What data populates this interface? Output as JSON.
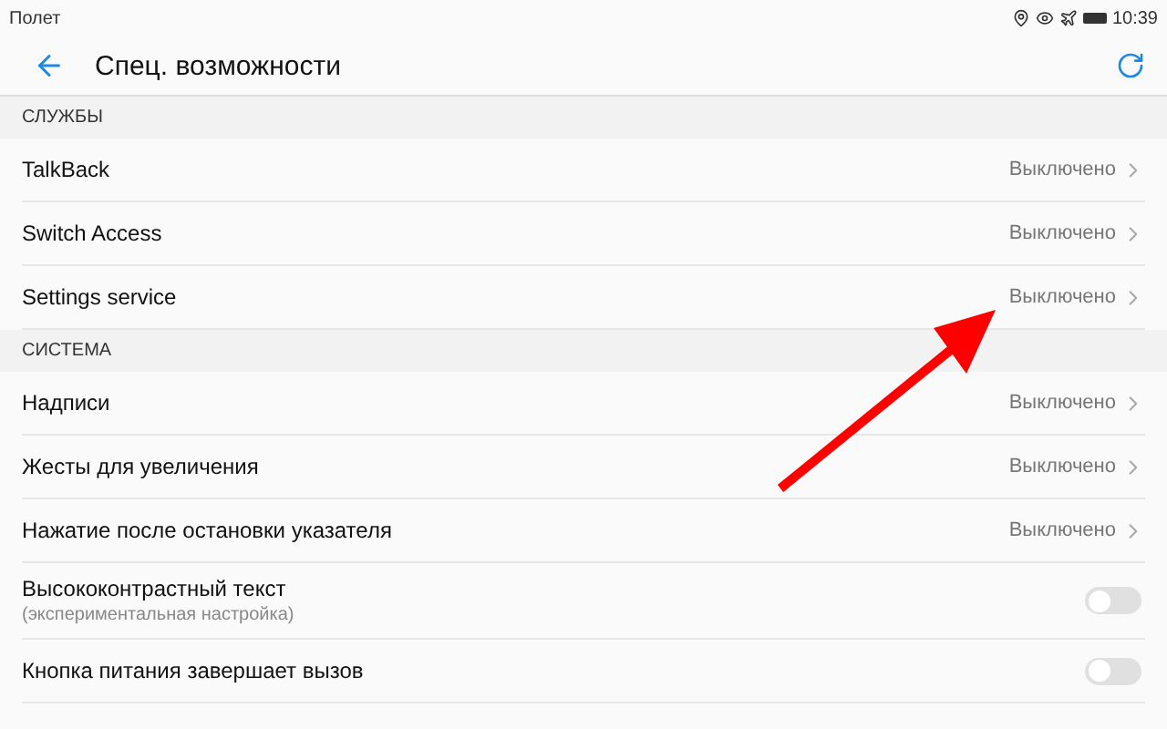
{
  "status_bar": {
    "carrier": "Полет",
    "time": "10:39"
  },
  "header": {
    "title": "Спец. возможности"
  },
  "sections": [
    {
      "title": "СЛУЖБЫ",
      "rows": [
        {
          "kind": "link",
          "label": "TalkBack",
          "value": "Выключено"
        },
        {
          "kind": "link",
          "label": "Switch Access",
          "value": "Выключено"
        },
        {
          "kind": "link",
          "label": "Settings service",
          "value": "Выключено"
        }
      ]
    },
    {
      "title": "СИСТЕМА",
      "rows": [
        {
          "kind": "link",
          "label": "Надписи",
          "value": "Выключено"
        },
        {
          "kind": "link",
          "label": "Жесты для увеличения",
          "value": "Выключено"
        },
        {
          "kind": "link",
          "label": "Нажатие после остановки указателя",
          "value": "Выключено"
        },
        {
          "kind": "toggle",
          "label": "Высококонтрастный текст",
          "subtitle": "(экспериментальная настройка)",
          "on": false
        },
        {
          "kind": "toggle",
          "label": "Кнопка питания завершает вызов",
          "on": false
        }
      ]
    }
  ]
}
